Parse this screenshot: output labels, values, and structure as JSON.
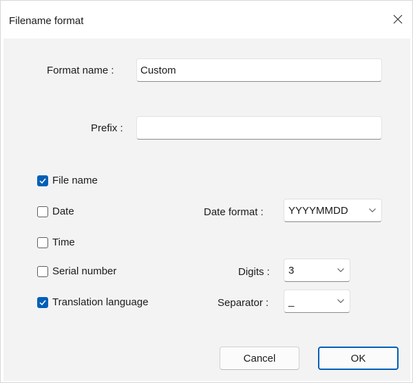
{
  "window": {
    "title": "Filename format",
    "close_icon": "close-icon"
  },
  "fields": {
    "format_name_label": "Format name :",
    "format_name_value": "Custom",
    "prefix_label": "Prefix :",
    "prefix_value": ""
  },
  "options": {
    "file_name": {
      "label": "File name",
      "checked": true
    },
    "date": {
      "label": "Date",
      "checked": false
    },
    "time": {
      "label": "Time",
      "checked": false
    },
    "serial_number": {
      "label": "Serial number",
      "checked": false
    },
    "translation_language": {
      "label": "Translation language",
      "checked": true
    }
  },
  "selects": {
    "date_format_label": "Date format :",
    "date_format_value": "YYYYMMDD",
    "digits_label": "Digits :",
    "digits_value": "3",
    "separator_label": "Separator :",
    "separator_value": "_"
  },
  "buttons": {
    "cancel": "Cancel",
    "ok": "OK"
  },
  "colors": {
    "accent": "#005fb8",
    "content_background": "#f3f3f3"
  }
}
